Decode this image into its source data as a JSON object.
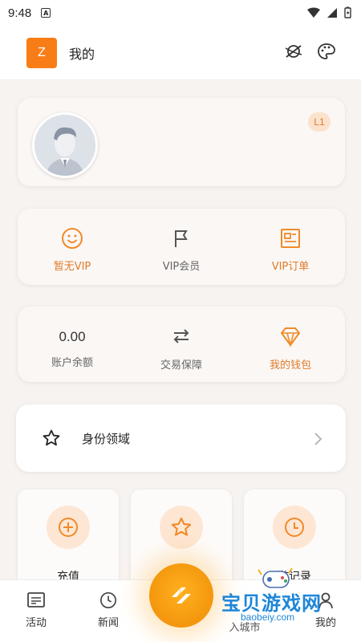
{
  "status_bar": {
    "time": "9:48",
    "a_icon": "A"
  },
  "header": {
    "avatar_letter": "Z",
    "title": "我的",
    "icons": [
      "theme-toggle-icon",
      "palette-icon"
    ]
  },
  "profile": {
    "level": "L1"
  },
  "vip_row": [
    {
      "label": "暂无VIP",
      "icon": "smile-icon",
      "color": "#e07b2a"
    },
    {
      "label": "VIP会员",
      "icon": "flag-icon",
      "color": "#666666"
    },
    {
      "label": "VIP订单",
      "icon": "id-card-icon",
      "color": "#e07b2a"
    }
  ],
  "wallet_row": [
    {
      "value": "0.00",
      "label": "账户余额"
    },
    {
      "label": "交易保障",
      "icon": "swap-icon"
    },
    {
      "label": "我的钱包",
      "icon": "diamond-icon",
      "color": "#e07b2a"
    }
  ],
  "identity": {
    "label": "身份领域"
  },
  "tiles": [
    {
      "label": "充值",
      "icon": "plus-circle-icon"
    },
    {
      "label": "",
      "icon": "star-icon"
    },
    {
      "label": "游记录",
      "icon": "clock-icon"
    }
  ],
  "bottom_nav": [
    {
      "label": "活动",
      "icon": "news-icon"
    },
    {
      "label": "新闻",
      "icon": "clock-icon"
    },
    {
      "label": "入城市",
      "icon": ""
    },
    {
      "label": "我的",
      "icon": "user-icon"
    }
  ],
  "watermark": {
    "text": "宝贝游戏网",
    "url": "baobeiy.com"
  },
  "colors": {
    "accent": "#f97d16",
    "orange_text": "#e07b2a",
    "card_bg": "#fbf7f5"
  }
}
